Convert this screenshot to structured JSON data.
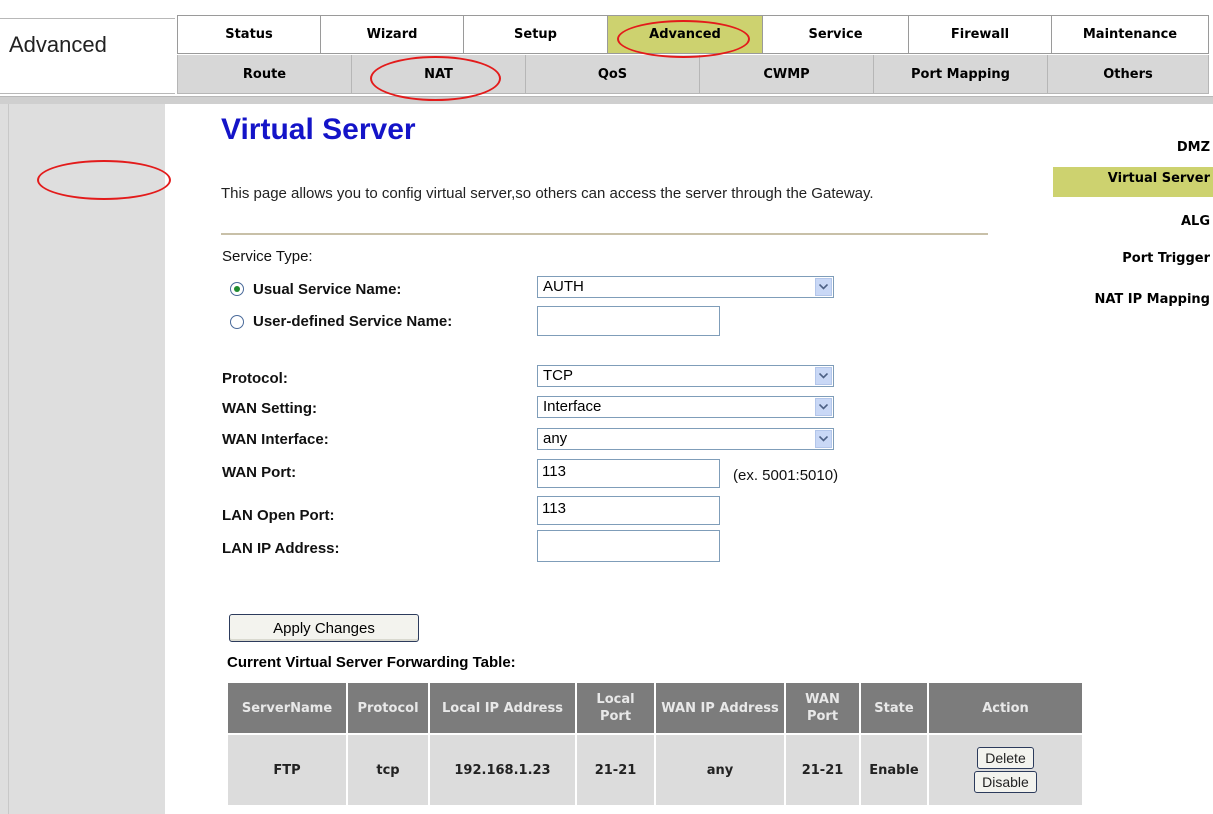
{
  "header": {
    "brand": "Advanced",
    "main_tabs": [
      {
        "label": "Status"
      },
      {
        "label": "Wizard"
      },
      {
        "label": "Setup"
      },
      {
        "label": "Advanced"
      },
      {
        "label": "Service"
      },
      {
        "label": "Firewall"
      },
      {
        "label": "Maintenance"
      }
    ],
    "sub_tabs": [
      {
        "label": "Route"
      },
      {
        "label": "NAT"
      },
      {
        "label": "QoS"
      },
      {
        "label": "CWMP"
      },
      {
        "label": "Port Mapping"
      },
      {
        "label": "Others"
      }
    ],
    "active_main_tab": "Advanced",
    "active_sub_tab": "NAT"
  },
  "sidebar": {
    "items": [
      {
        "label": "DMZ"
      },
      {
        "label": "Virtual Server"
      },
      {
        "label": "ALG"
      },
      {
        "label": "Port Trigger"
      },
      {
        "label": "NAT IP Mapping"
      }
    ],
    "active": "Virtual Server"
  },
  "main": {
    "title": "Virtual Server",
    "description": "This page allows you to config virtual server,so others can access the server through the Gateway.",
    "service_type_label": "Service Type:",
    "usual_service_label": "Usual Service Name:",
    "usual_service_value": "AUTH",
    "user_defined_label": "User-defined Service Name:",
    "user_defined_value": "",
    "usual_selected": true,
    "protocol_label": "Protocol:",
    "protocol_value": "TCP",
    "wan_setting_label": "WAN Setting:",
    "wan_setting_value": "Interface",
    "wan_interface_label": "WAN Interface:",
    "wan_interface_value": "any",
    "wan_port_label": "WAN Port:",
    "wan_port_value": "113",
    "wan_port_hint": "(ex. 5001:5010)",
    "lan_open_port_label": "LAN Open Port:",
    "lan_open_port_value": "113",
    "lan_ip_label": "LAN IP Address:",
    "lan_ip_value": "",
    "apply_button": "Apply Changes"
  },
  "table": {
    "title": "Current Virtual Server Forwarding Table:",
    "headers": [
      "ServerName",
      "Protocol",
      "Local IP Address",
      "Local Port",
      "WAN IP Address",
      "WAN Port",
      "State",
      "Action"
    ],
    "rows": [
      {
        "server_name": "FTP",
        "protocol": "tcp",
        "local_ip": "192.168.1.23",
        "local_port": "21-21",
        "wan_ip": "any",
        "wan_port": "21-21",
        "state": "Enable",
        "delete_label": "Delete",
        "disable_label": "Disable"
      }
    ]
  },
  "colors": {
    "active_tab": "#cdd26f",
    "title_blue": "#1414c8",
    "annotation_red": "#e31b1b",
    "table_header": "#7c7c7c"
  }
}
